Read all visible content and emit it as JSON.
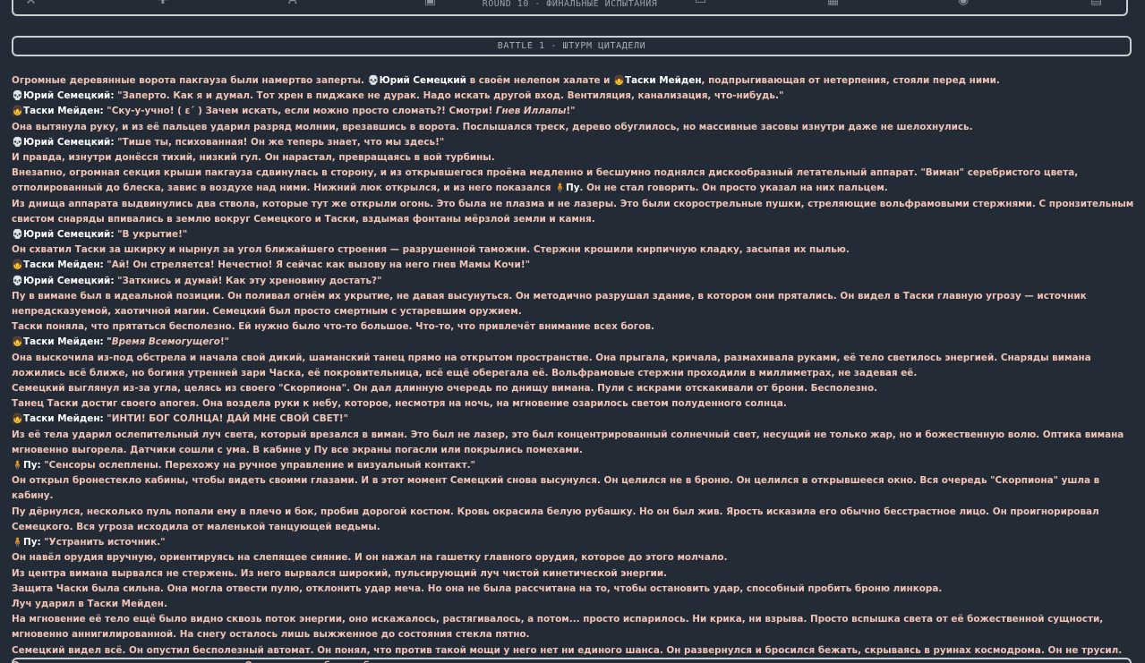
{
  "prev_section": {
    "title": "ROUND 10 - ФИНАЛЬНЫЕ ИСПЫТАНИЯ"
  },
  "battle": {
    "title": "BATTLE 1 - ШТУРМ ЦИТАДЕЛИ"
  },
  "names": {
    "yuriy": "Юрий Семецкий",
    "tasky": "Таски Мейден",
    "pu": "Пу"
  },
  "icons": {
    "yuriy": "skull-icon",
    "tasky": "girl-icon",
    "pu": "pu-icon"
  },
  "story": {
    "p1": {
      "a": "Огромные деревянные ворота пакгауза были намертво заперты. ",
      "b": " в своём нелепом халате и ",
      "c": ", подпрыгивающая от нетерпения, стояли перед ними."
    },
    "l2": "\"Заперто. Как я и думал. Тот хрен в пиджаке не дурак. Надо искать другой вход. Вентиляция, канализация, что-нибудь.\"",
    "l3": {
      "a": "\"Ску-у-учно! ( ε´ ) Зачем искать, если можно просто сломать?! Смотри! ",
      "em": "Гнев Иллапы",
      "b": "!\""
    },
    "p4": "Она вытянула руку, и из её пальцев ударил разряд молнии, врезавшись в ворота. Послышался треск, дерево обуглилось, но массивные засовы изнутри даже не шелохнулись.",
    "l5": "\"Тише ты, психованная! Он же теперь знает, что мы здесь!\"",
    "p6": "И правда, изнутри донёсся тихий, низкий гул. Он нарастал, превращаясь в вой турбины.",
    "p7": {
      "a": "Внезапно, огромная секция крыши пакгауза сдвинулась в сторону, и из открывшегося проёма медленно и бесшумно поднялся дискообразный летательный аппарат. \"Виман\" серебристого цвета, отполированный до блеска, завис в воздухе над ними. Нижний люк открылся, и из него показался ",
      "b": ". Он не стал говорить. Он просто указал на них пальцем."
    },
    "p8": "Из днища аппарата выдвинулись два ствола, которые тут же открыли огонь. Это была не плазма и не лазеры. Это были скорострельные пушки, стреляющие вольфрамовыми стержнями. С пронзительным свистом снаряды впивались в землю вокруг Семецкого и Таски, вздымая фонтаны мёрзлой земли и камня.",
    "l9": "\"В укрытие!\"",
    "p10": "Он схватил Таски за шкирку и нырнул за угол ближайшего строения — разрушенной таможни. Стержни крошили кирпичную кладку, засыпая их пылью.",
    "l11": "\"Ай! Он стреляется! Нечестно! Я сейчас как вызову на него гнев Мамы Кочи!\"",
    "l12": "\"Заткнись и думай! Как эту хреновину достать?\"",
    "p13": "Пу в вимане был в идеальной позиции. Он поливал огнём их укрытие, не давая высунуться. Он методично разрушал здание, в котором они прятались. Он видел в Таски главную угрозу — источник непредсказуемой, хаотичной магии. Семецкий был просто смертным с устаревшим оружием.",
    "p14": "Таски поняла, что прятаться бесполезно. Ей нужно было что-то большое. Что-то, что привлечёт внимание всех богов.",
    "l15": {
      "em": "Время Всемогущего",
      "b": "!\""
    },
    "p16": "Она выскочила из-под обстрела и начала свой дикий, шаманский танец прямо на открытом пространстве. Она прыгала, кричала, размахивала руками, её тело светилось энергией. Снаряды вимана ложились всё ближе, но богиня утренней зари Часка, её покровительница, всё ещё оберегала её. Вольфрамовые стержни проходили в миллиметрах, не задевая её.",
    "p17": "Семецкий выглянул из-за угла, целясь из своего \"Скорпиона\". Он дал длинную очередь по днищу вимана. Пули с искрами отскакивали от брони. Бесполезно.",
    "p18": "Танец Таски достиг своего апогея. Она воздела руки к небу, которое, несмотря на ночь, на мгновение озарилось светом полуденного солнца.",
    "l19": "\"ИНТИ! БОГ СОЛНЦА! ДАЙ МНЕ СВОЙ СВЕТ!\"",
    "p20": "Из её тела ударил ослепительный луч света, который врезался в виман. Это был не лазер, это был концентрированный солнечный свет, несущий не только жар, но и божественную волю. Оптика вимана мгновенно выгорела. Датчики сошли с ума. В кабине у Пу все экраны погасли или покрылись помехами.",
    "l21": "\"Сенсоры ослеплены. Перехожу на ручное управление и визуальный контакт.\"",
    "p22": "Он открыл бронестекло кабины, чтобы видеть своими глазами. И в этот момент Семецкий снова высунулся. Он целился не в броню. Он целился в открывшееся окно. Вся очередь \"Скорпиона\" ушла в кабину.",
    "p23": "Пу дёрнулся, несколько пуль попали ему в плечо и бок, пробив дорогой костюм. Кровь окрасила белую рубашку. Но он был жив. Ярость исказила его обычно бесстрастное лицо. Он проигнорировал Семецкого. Вся угроза исходила от маленькой танцующей ведьмы.",
    "l24": "\"Устранить источник.\"",
    "p25": "Он навёл орудия вручную, ориентируясь на слепящее сияние. И он нажал на гашетку главного орудия, которое до этого молчало.",
    "p26": "Из центра вимана вырвался не стержень. Из него вырвался широкий, пульсирующий луч чистой кинетической энергии.",
    "p27": "Защита Часки была сильна. Она могла отвести пулю, отклонить удар меча. Но она не была рассчитана на то, чтобы остановить удар, способный пробить броню линкора.",
    "p28": "Луч ударил в Таски Мейден.",
    "p29": "На мгновение её тело ещё было видно сквозь поток энергии, оно искажалось, растягивалось, а потом... просто испарилось. Ни крика, ни взрыва. Просто вспышка света от её божественной сущности, мгновенно аннигилированной. На снегу осталось лишь выжженное до состояния стекла пятно.",
    "p30": "Семецкий видел всё. Он опустил бесполезный автомат. Он понял, что против такой мощи у него нет ни единого шанса. Он развернулся и бросился бежать, скрываясь в руинах космодрома. Он не трусил. Он отправлялся на поиски нового оружия. Оружия, способного сбить эту летающую смерть."
  }
}
